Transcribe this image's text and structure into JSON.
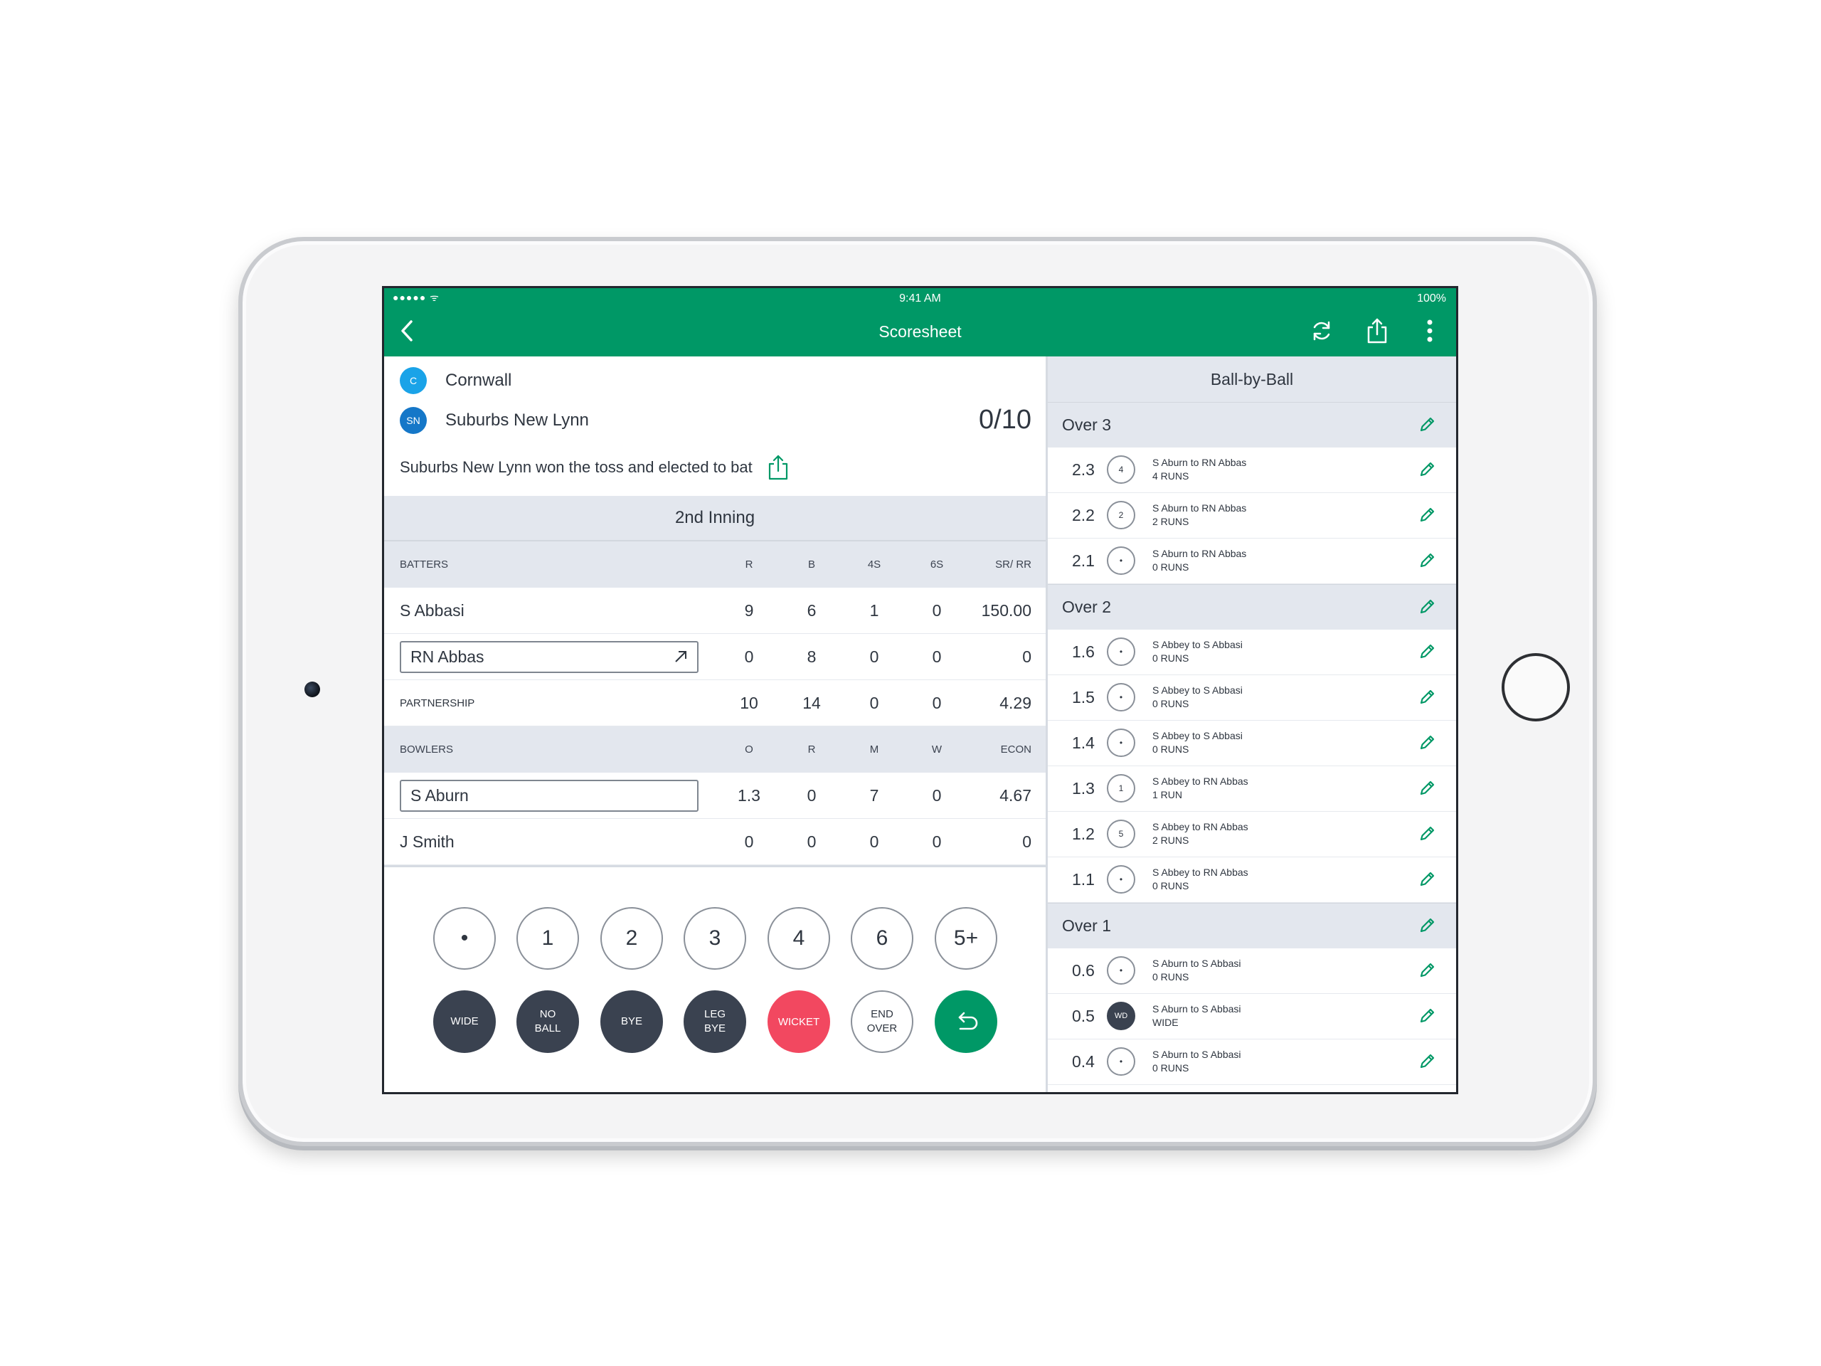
{
  "status_bar": {
    "signal": "●●●●● ᯤ",
    "time": "9:41 AM",
    "battery": "100%"
  },
  "nav": {
    "title": "Scoresheet"
  },
  "teams": [
    {
      "badge": "C",
      "name": "Cornwall",
      "color": "#1aa3e8"
    },
    {
      "badge": "SN",
      "name": "Suburbs New Lynn",
      "color": "#1577c8"
    }
  ],
  "score": "0/10",
  "toss_text": "Suburbs New Lynn won the toss and elected to bat",
  "inning": "2nd Inning",
  "batters": {
    "headers": [
      "BATTERS",
      "R",
      "B",
      "4S",
      "6S",
      "SR/ RR"
    ],
    "rows": [
      {
        "name": "S Abbasi",
        "r": "9",
        "b": "6",
        "fours": "1",
        "sixes": "0",
        "sr": "150.00"
      },
      {
        "name": "RN Abbas",
        "r": "0",
        "b": "8",
        "fours": "0",
        "sixes": "0",
        "sr": "0"
      }
    ],
    "partnership": {
      "label": "PARTNERSHIP",
      "r": "10",
      "b": "14",
      "fours": "0",
      "sixes": "0",
      "sr": "4.29"
    }
  },
  "bowlers": {
    "headers": [
      "BOWLERS",
      "O",
      "R",
      "M",
      "W",
      "ECON"
    ],
    "rows": [
      {
        "name": "S Aburn",
        "o": "1.3",
        "r": "0",
        "m": "7",
        "w": "0",
        "econ": "4.67"
      },
      {
        "name": "J Smith",
        "o": "0",
        "r": "0",
        "m": "0",
        "w": "0",
        "econ": "0"
      }
    ]
  },
  "keypad": {
    "runs": [
      "•",
      "1",
      "2",
      "3",
      "4",
      "6",
      "5+"
    ],
    "extras": {
      "wide": "WIDE",
      "no_ball_1": "NO",
      "no_ball_2": "BALL",
      "bye": "BYE",
      "leg_bye_1": "LEG",
      "leg_bye_2": "BYE",
      "wicket": "WICKET",
      "end_over_1": "END",
      "end_over_2": "OVER"
    }
  },
  "ball_by_ball": {
    "title": "Ball-by-Ball",
    "overs": [
      {
        "label": "Over 3",
        "balls": [
          {
            "num": "2.3",
            "mark": "4",
            "desc": "S Aburn to RN Abbas",
            "result": "4 RUNS"
          },
          {
            "num": "2.2",
            "mark": "2",
            "desc": "S Aburn to RN Abbas",
            "result": "2 RUNS"
          },
          {
            "num": "2.1",
            "mark": "•",
            "desc": "S Aburn to RN Abbas",
            "result": "0 RUNS"
          }
        ]
      },
      {
        "label": "Over 2",
        "balls": [
          {
            "num": "1.6",
            "mark": "•",
            "desc": "S Abbey to S Abbasi",
            "result": "0 RUNS"
          },
          {
            "num": "1.5",
            "mark": "•",
            "desc": "S Abbey to S Abbasi",
            "result": "0 RUNS"
          },
          {
            "num": "1.4",
            "mark": "•",
            "desc": "S Abbey to S Abbasi",
            "result": "0 RUNS"
          },
          {
            "num": "1.3",
            "mark": "1",
            "desc": "S Abbey to RN Abbas",
            "result": "1 RUN"
          },
          {
            "num": "1.2",
            "mark": "5",
            "desc": "S Abbey to RN Abbas",
            "result": "2 RUNS"
          },
          {
            "num": "1.1",
            "mark": "•",
            "desc": "S Abbey to RN Abbas",
            "result": "0 RUNS"
          }
        ]
      },
      {
        "label": "Over 1",
        "balls": [
          {
            "num": "0.6",
            "mark": "•",
            "desc": "S Aburn to S Abbasi",
            "result": "0 RUNS"
          },
          {
            "num": "0.5",
            "mark": "WD",
            "desc": "S Aburn to S Abbasi",
            "result": "WIDE"
          },
          {
            "num": "0.4",
            "mark": "•",
            "desc": "S Aburn to S Abbasi",
            "result": "0 RUNS"
          }
        ]
      }
    ]
  },
  "colors": {
    "brand": "#009866",
    "wicket": "#f24860",
    "dark_key": "#3a4250",
    "band": "#e3e7ee"
  }
}
